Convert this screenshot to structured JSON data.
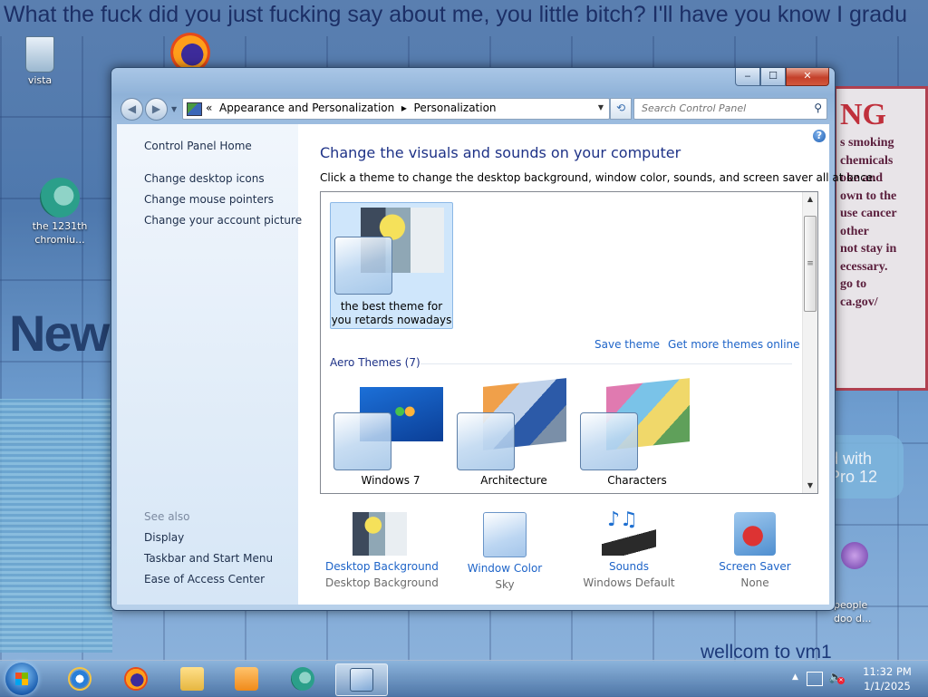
{
  "desktop": {
    "wallpaper_text": "What the fuck did you just fucking say about me, you little bitch? I'll have you know I gradu",
    "wallpaper_banner": "Newp",
    "warning_title": "NG",
    "warning_body": "s smoking\nchemicals\noke and\nown to the\nuse cancer\nother\nnot stay in\necessary.\ngo to\nca.gov/",
    "bubble_text": "d with\nPro 12",
    "welcome_text": "wellcom to vm1",
    "icons": [
      {
        "label": "vista",
        "icon": "recycle-bin-icon"
      },
      {
        "label": "",
        "icon": "firefox-icon"
      },
      {
        "label": "the 1231th chromiu...",
        "icon": "chromium-icon"
      },
      {
        "label": "people\ndoo d...",
        "icon": "people-icon"
      }
    ]
  },
  "window": {
    "caption_buttons": {
      "minimize": "‒",
      "maximize": "☐",
      "close": "✕"
    },
    "nav": {
      "back": "◀",
      "forward": "▶"
    },
    "address": {
      "prefix": "«",
      "crumbs": [
        "Appearance and Personalization",
        "Personalization"
      ],
      "separator": "▸"
    },
    "search_placeholder": "Search Control Panel",
    "sidebar": {
      "home": "Control Panel Home",
      "links": [
        "Change desktop icons",
        "Change mouse pointers",
        "Change your account picture"
      ],
      "see_also_title": "See also",
      "see_also": [
        "Display",
        "Taskbar and Start Menu",
        "Ease of Access Center"
      ]
    },
    "main": {
      "title": "Change the visuals and sounds on your computer",
      "subtitle": "Click a theme to change the desktop background, window color, sounds, and screen saver all at once.",
      "my_theme_label": "the best theme for you retards nowadays",
      "save_theme": "Save theme",
      "get_more": "Get more themes online",
      "aero_group": "Aero Themes (7)",
      "aero_themes": [
        {
          "label": "Windows 7"
        },
        {
          "label": "Architecture"
        },
        {
          "label": "Characters"
        }
      ],
      "bottom": [
        {
          "title": "Desktop Background",
          "value": "Desktop Background",
          "icon": "desktop-background-icon"
        },
        {
          "title": "Window Color",
          "value": "Sky",
          "icon": "window-color-icon"
        },
        {
          "title": "Sounds",
          "value": "Windows Default",
          "icon": "sounds-icon"
        },
        {
          "title": "Screen Saver",
          "value": "None",
          "icon": "screen-saver-icon"
        }
      ]
    }
  },
  "taskbar": {
    "clock_time": "11:32 PM",
    "clock_date": "1/1/2025",
    "tray_arrow": "▲"
  }
}
